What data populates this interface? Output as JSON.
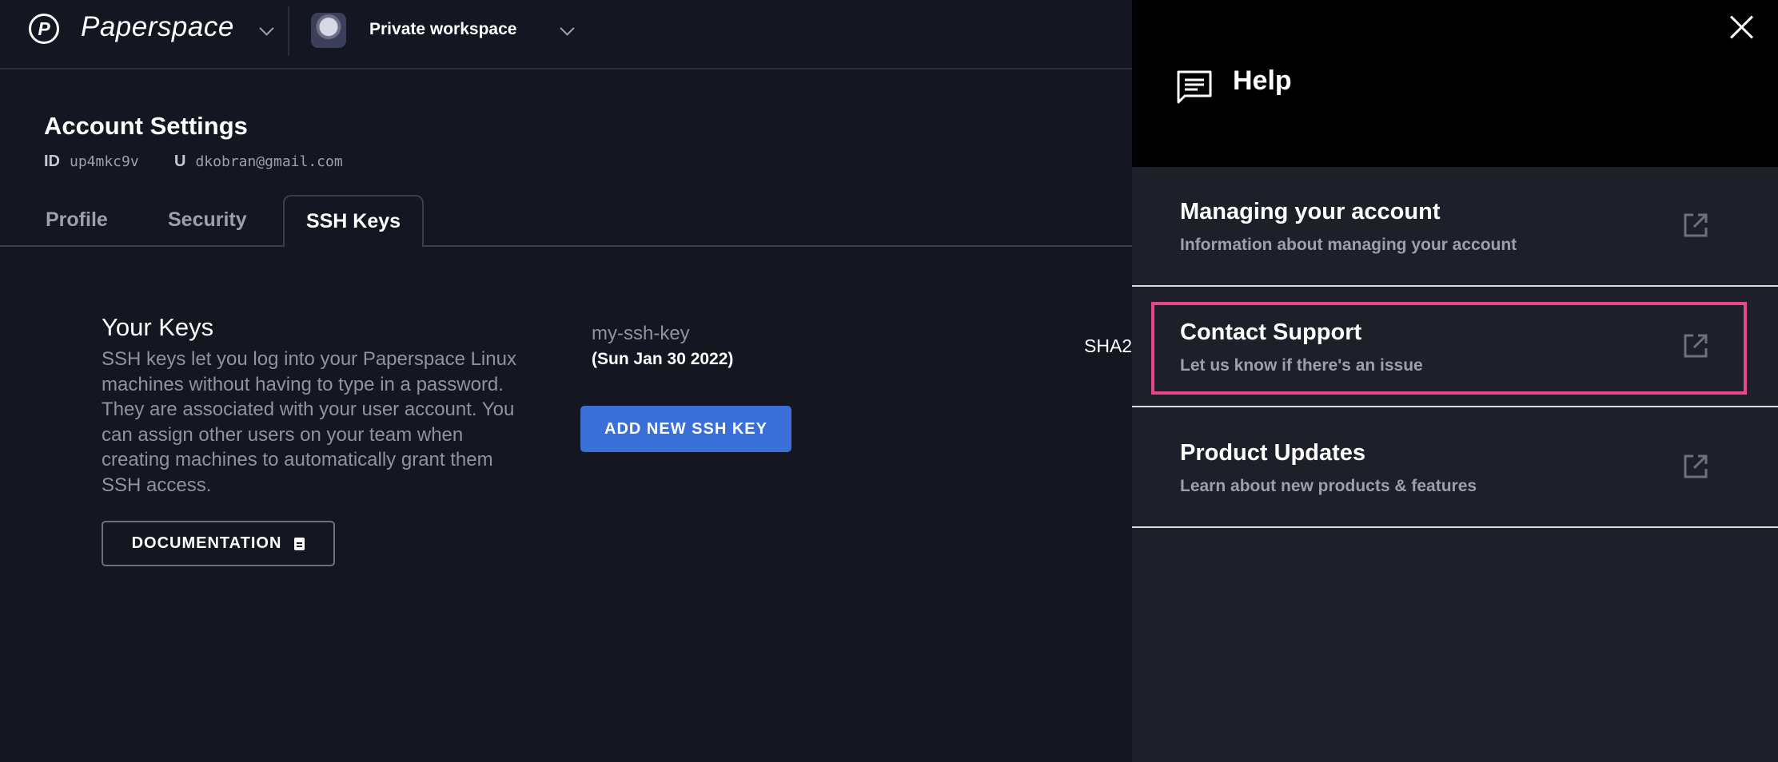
{
  "header": {
    "logo_letter": "P",
    "brand": "Paperspace",
    "workspace": "Private workspace"
  },
  "account": {
    "title": "Account Settings",
    "id_label": "ID",
    "id_value": "up4mkc9v",
    "user_label": "U",
    "user_value": "dkobran@gmail.com"
  },
  "tabs": [
    {
      "label": "Profile",
      "active": false
    },
    {
      "label": "Security",
      "active": false
    },
    {
      "label": "SSH Keys",
      "active": true
    }
  ],
  "keys": {
    "title": "Your Keys",
    "description": "SSH keys let you log into your Paperspace Linux machines without having to type in a password. They are associated with your user account. You can assign other users on your team when creating machines to automatically grant them SSH access.",
    "documentation_label": "DOCUMENTATION",
    "key_name": "my-ssh-key",
    "key_date": "(Sun Jan 30 2022)",
    "add_label": "ADD NEW SSH KEY",
    "fingerprint_prefix": "SHA2"
  },
  "help": {
    "title": "Help",
    "items": [
      {
        "title": "Managing your account",
        "subtitle": "Information about managing your account"
      },
      {
        "title": "Contact Support",
        "subtitle": "Let us know if there's an issue"
      },
      {
        "title": "Product Updates",
        "subtitle": "Learn about new products & features"
      }
    ]
  },
  "colors": {
    "background": "#141721",
    "panel": "#1d2029",
    "accent_button": "#3a6fd8",
    "highlight": "#e8468d"
  }
}
